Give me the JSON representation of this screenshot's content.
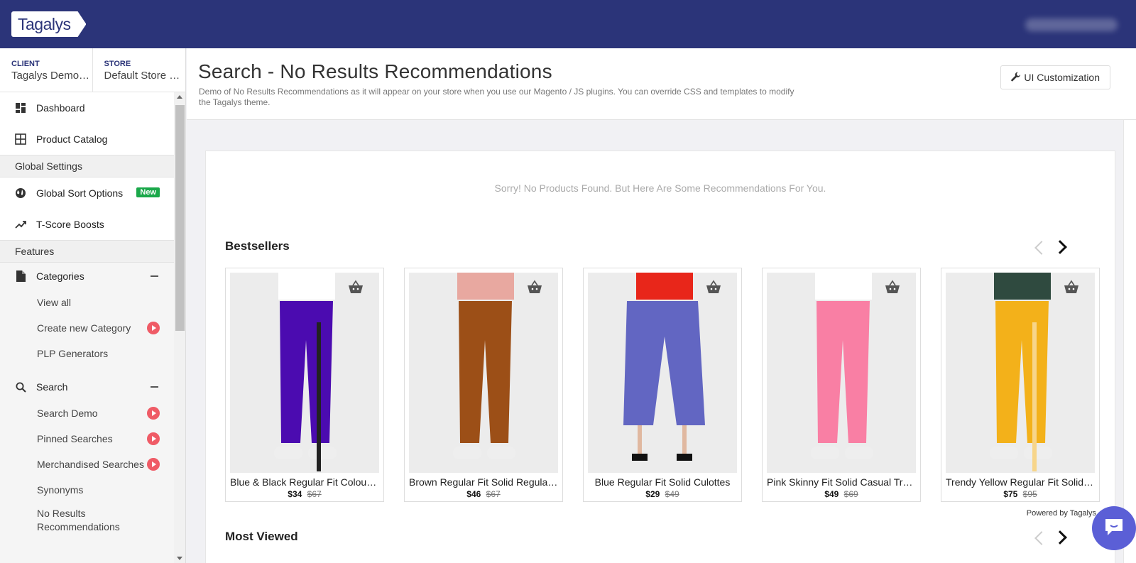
{
  "header": {
    "logo_text": "Tagalys"
  },
  "selectors": {
    "client_label": "CLIENT",
    "client_value": "Tagalys Demo …",
    "store_label": "STORE",
    "store_value": "Default Store …"
  },
  "sidebar": {
    "dashboard": "Dashboard",
    "product_catalog": "Product Catalog",
    "global_settings_title": "Global Settings",
    "global_sort_options": "Global Sort Options",
    "new_badge": "New",
    "tscore_boosts": "T-Score Boosts",
    "features_title": "Features",
    "categories": "Categories",
    "categories_items": [
      "View all",
      "Create new Category",
      "PLP Generators"
    ],
    "search": "Search",
    "search_items": [
      "Search Demo",
      "Pinned Searches",
      "Merchandised Searches",
      "Synonyms",
      "No Results Recommendations"
    ]
  },
  "page": {
    "title": "Search - No Results Recommendations",
    "description": "Demo of No Results Recommendations as it will appear on your store when you use our Magento / JS plugins. You can override CSS and templates to modify the Tagalys theme.",
    "ui_button": "UI Customization",
    "sorry_text": "Sorry! No Products Found. But Here Are Some Recommendations For You.",
    "widget_title": "Bestsellers",
    "powered_by": "Powered by Tagalys",
    "second_widget_title": "Most Viewed"
  },
  "products": [
    {
      "name": "Blue & Black Regular Fit Colour…",
      "price": "$34",
      "old_price": "$67",
      "pants_color": "#4b0bb0",
      "top_color": "#ffffff",
      "stripe": "#222222"
    },
    {
      "name": "Brown Regular Fit Solid Regular…",
      "price": "$46",
      "old_price": "$67",
      "pants_color": "#9c4f17",
      "top_color": "#e8a8a0",
      "stripe": ""
    },
    {
      "name": "Blue Regular Fit Solid Culottes",
      "price": "$29",
      "old_price": "$49",
      "pants_color": "#6266c2",
      "top_color": "#e8261a",
      "stripe": ""
    },
    {
      "name": "Pink Skinny Fit Solid Casual Tro…",
      "price": "$49",
      "old_price": "$69",
      "pants_color": "#f97fa4",
      "top_color": "#ffffff",
      "stripe": ""
    },
    {
      "name": "Trendy Yellow Regular Fit Solid …",
      "price": "$75",
      "old_price": "$95",
      "pants_color": "#f3b11a",
      "top_color": "#2f4a3f",
      "stripe": "#f7d58a"
    }
  ]
}
